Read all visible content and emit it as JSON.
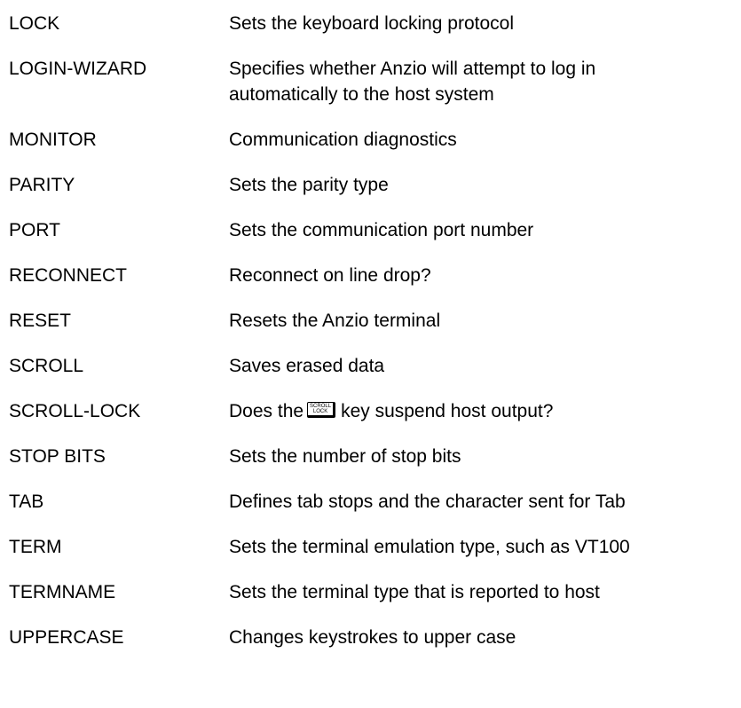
{
  "commands": [
    {
      "name": "LOCK",
      "description": [
        "Sets the keyboard locking protocol"
      ]
    },
    {
      "name": "LOGIN-WIZARD",
      "description": [
        "Specifies whether Anzio will attempt to log in",
        "automatically to the host system"
      ]
    },
    {
      "name": "MONITOR",
      "description": [
        "Communication diagnostics"
      ]
    },
    {
      "name": "PARITY",
      "description": [
        "Sets the parity type"
      ]
    },
    {
      "name": "PORT",
      "description": [
        "Sets the communication port number"
      ]
    },
    {
      "name": "RECONNECT",
      "description": [
        "Reconnect on line drop?"
      ]
    },
    {
      "name": "RESET",
      "description": [
        "Resets the Anzio terminal"
      ]
    },
    {
      "name": "SCROLL",
      "description": [
        "Saves erased data"
      ]
    },
    {
      "name": "SCROLL-LOCK",
      "description_before": "Does the",
      "keycap": [
        "SCROLL",
        "LOCK"
      ],
      "description_after": "key suspend host output?"
    },
    {
      "name": "STOP BITS",
      "description": [
        "Sets the number of stop bits"
      ]
    },
    {
      "name": "TAB",
      "description": [
        "Defines tab stops and the character sent for Tab"
      ]
    },
    {
      "name": "TERM",
      "description": [
        "Sets the terminal emulation type, such as VT100"
      ]
    },
    {
      "name": "TERMNAME",
      "description": [
        "Sets the terminal type that is reported to host"
      ]
    },
    {
      "name": "UPPERCASE",
      "description": [
        "Changes keystrokes to upper case"
      ]
    }
  ]
}
